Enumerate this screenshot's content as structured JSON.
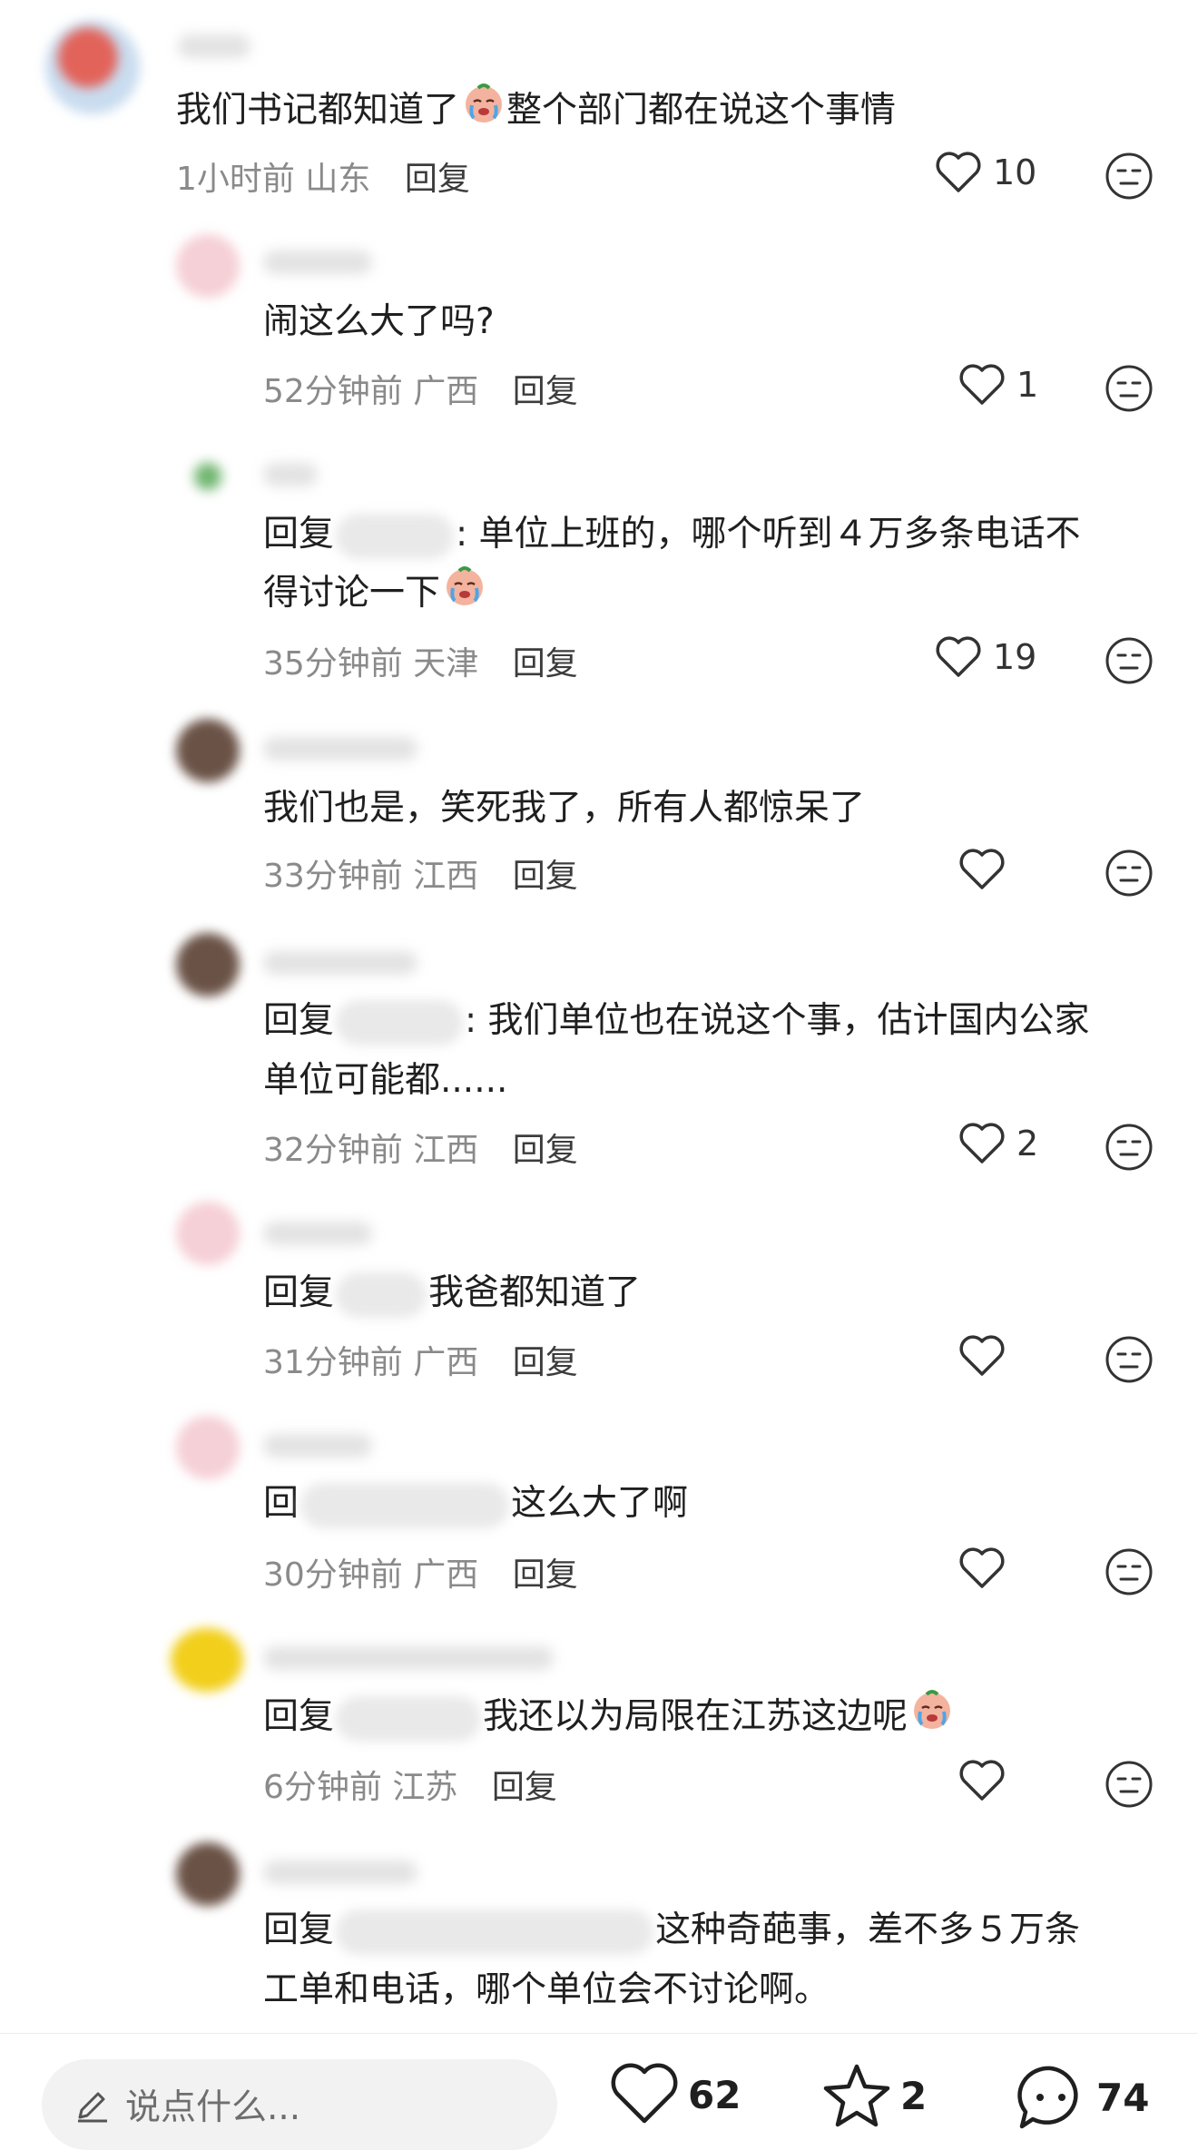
{
  "comments": [
    {
      "level": "top",
      "text": "我们书记都知道了",
      "text_after_emoji": "整个部门都在说这个事情",
      "emoji": "crying-face-emoji",
      "time": "1小时前",
      "location": "山东",
      "reply_label": "回复",
      "likes": "10"
    },
    {
      "level": "reply",
      "text": "闹这么大了吗?",
      "time": "52分钟前",
      "location": "广西",
      "reply_label": "回复",
      "likes": "1"
    },
    {
      "level": "reply",
      "text_prefix": "回复",
      "text": ": 单位上班的，哪个听到４万多条电话不",
      "text_line2": "得讨论一下",
      "emoji": "crying-face-emoji",
      "time": "35分钟前",
      "location": "天津",
      "reply_label": "回复",
      "likes": "19"
    },
    {
      "level": "reply",
      "text": "我们也是，笑死我了，所有人都惊呆了",
      "time": "33分钟前",
      "location": "江西",
      "reply_label": "回复",
      "likes": ""
    },
    {
      "level": "reply",
      "text_prefix": "回复",
      "text": ": 我们单位也在说这个事，估计国内公家",
      "text_line2": "单位可能都......",
      "time": "32分钟前",
      "location": "江西",
      "reply_label": "回复",
      "likes": "2"
    },
    {
      "level": "reply",
      "text_prefix": "回复",
      "text": "我爸都知道了",
      "time": "31分钟前",
      "location": "广西",
      "reply_label": "回复",
      "likes": ""
    },
    {
      "level": "reply",
      "text_prefix": "回",
      "text": "这么大了啊",
      "time": "30分钟前",
      "location": "广西",
      "reply_label": "回复",
      "likes": ""
    },
    {
      "level": "reply",
      "text_prefix": "回复",
      "text": "我还以为局限在江苏这边呢",
      "emoji": "crying-face-emoji",
      "time": "6分钟前",
      "location": "江苏",
      "reply_label": "回复",
      "likes": ""
    },
    {
      "level": "reply",
      "text_prefix": "回复",
      "text": "这种奇葩事，差不多５万条",
      "text_line2": "工单和电话，哪个单位会不讨论啊。"
    }
  ],
  "bottom_bar": {
    "input_placeholder": "说点什么...",
    "like_count": "62",
    "favorite_count": "2",
    "comment_count": "74"
  },
  "colors": {
    "text": "#1f1f1f",
    "meta": "#8a8a8a",
    "icon": "#333333"
  }
}
